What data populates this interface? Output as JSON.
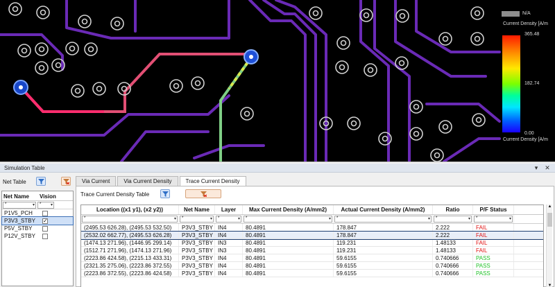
{
  "legend": {
    "na_label": "N/A",
    "title": "Current Density [A/m",
    "max": "365.48",
    "mid": "182.74",
    "min": "0.00",
    "bottom_title": "Current Density [A/m"
  },
  "panel": {
    "title": "Simulation Table",
    "controls": [
      "▾",
      "✕"
    ]
  },
  "net_table": {
    "label": "Net Table",
    "columns": [
      "Net Name",
      "Vision"
    ],
    "filter_placeholder": "*",
    "rows": [
      {
        "name": "P1V5_PCH",
        "vision": "",
        "selected": false
      },
      {
        "name": "P3V3_STBY",
        "vision": "✓",
        "selected": true
      },
      {
        "name": "P5V_STBY",
        "vision": "",
        "selected": false
      },
      {
        "name": "P12V_STBY",
        "vision": "",
        "selected": false
      }
    ]
  },
  "tabs": [
    "Via Current",
    "Via Current Density",
    "Trace Current Density"
  ],
  "active_tab": "Trace Current Density",
  "table": {
    "title": "Trace Current Density Table",
    "columns": [
      "Location ((x1 y1), (x2 y2))",
      "Net Name",
      "Layer",
      "Max Current Density (A/mm2)",
      "Actual Current Density (A/mm2)",
      "Ratio",
      "P/F Status"
    ],
    "filter_placeholder": "*",
    "rows": [
      [
        "(2495.53 626.28), (2495.53 532.50)",
        "P3V3_STBY",
        "IN4",
        "80.4891",
        "178.847",
        "2.222",
        "FAIL"
      ],
      [
        "(2532.02 662.77), (2495.53 626.28)",
        "P3V3_STBY",
        "IN4",
        "80.4891",
        "178.847",
        "2.222",
        "FAIL"
      ],
      [
        "(1474.13 271.96), (1446.95 299.14)",
        "P3V3_STBY",
        "IN3",
        "80.4891",
        "119.231",
        "1.48133",
        "FAIL"
      ],
      [
        "(1512.71 271.96), (1474.13 271.96)",
        "P3V3_STBY",
        "IN3",
        "80.4891",
        "119.231",
        "1.48133",
        "FAIL"
      ],
      [
        "(2223.86 424.58), (2215.13 433.31)",
        "P3V3_STBY",
        "IN4",
        "80.4891",
        "59.6155",
        "0.740666",
        "PASS"
      ],
      [
        "(2321.35 275.06), (2223.86 372.55)",
        "P3V3_STBY",
        "IN4",
        "80.4891",
        "59.6155",
        "0.740666",
        "PASS"
      ],
      [
        "(2223.86 372.55), (2223.86 424.58)",
        "P3V3_STBY",
        "IN4",
        "80.4891",
        "59.6155",
        "0.740666",
        "PASS"
      ]
    ],
    "selected_row": 1
  },
  "colors": {
    "fail": "#e21414",
    "pass": "#22c22a",
    "trace_purple": "#7a2fc0",
    "trace_hot": "#ff2d6e"
  }
}
